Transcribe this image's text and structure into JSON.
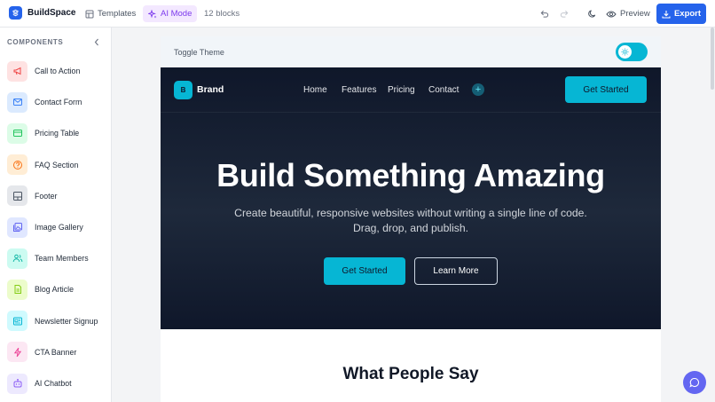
{
  "app": {
    "name": "BuildSpace",
    "templates_label": "Templates",
    "ai_mode_label": "AI Mode",
    "blocks_count": "12 blocks",
    "preview_label": "Preview",
    "export_label": "Export"
  },
  "sidebar": {
    "heading": "COMPONENTS",
    "items": [
      {
        "label": "Call to Action",
        "icon": "megaphone-icon",
        "bg": "#fee2e2",
        "fg": "#ef4444"
      },
      {
        "label": "Contact Form",
        "icon": "mail-icon",
        "bg": "#dbeafe",
        "fg": "#3b82f6"
      },
      {
        "label": "Pricing Table",
        "icon": "card-icon",
        "bg": "#dcfce7",
        "fg": "#22c55e"
      },
      {
        "label": "FAQ Section",
        "icon": "help-circle-icon",
        "bg": "#ffedd5",
        "fg": "#f97316"
      },
      {
        "label": "Footer",
        "icon": "layout-icon",
        "bg": "#e5e7eb",
        "fg": "#4b5563"
      },
      {
        "label": "Image Gallery",
        "icon": "images-icon",
        "bg": "#e0e7ff",
        "fg": "#6366f1"
      },
      {
        "label": "Team Members",
        "icon": "users-icon",
        "bg": "#ccfbf1",
        "fg": "#14b8a6"
      },
      {
        "label": "Blog Article",
        "icon": "document-icon",
        "bg": "#ecfccb",
        "fg": "#84cc16"
      },
      {
        "label": "Newsletter Signup",
        "icon": "newspaper-icon",
        "bg": "#cffafe",
        "fg": "#06b6d4"
      },
      {
        "label": "CTA Banner",
        "icon": "zap-icon",
        "bg": "#fce7f3",
        "fg": "#ec4899"
      },
      {
        "label": "AI Chatbot",
        "icon": "bot-icon",
        "bg": "#ede9fe",
        "fg": "#8b5cf6"
      }
    ]
  },
  "canvas": {
    "toggle_label": "Toggle Theme",
    "brand_initial": "B",
    "brand_name": "Brand",
    "nav_links": [
      "Home",
      "Features",
      "Pricing",
      "Contact"
    ],
    "nav_plus": "+",
    "nav_cta": "Get Started",
    "hero_title": "Build Something Amazing",
    "hero_sub_line1": "Create beautiful, responsive websites without writing a single line of code.",
    "hero_sub_line2": "Drag, drop, and publish.",
    "hero_primary": "Get Started",
    "hero_secondary": "Learn More",
    "section_title": "What People Say"
  },
  "colors": {
    "accent": "#2563eb",
    "cyan": "#06b6d4",
    "hero_bg": "#0f172a"
  }
}
